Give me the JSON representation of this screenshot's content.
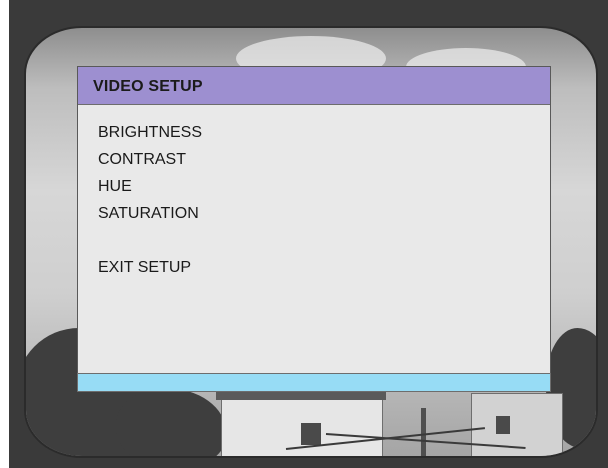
{
  "menu": {
    "title": "VIDEO SETUP",
    "items": [
      {
        "label": "BRIGHTNESS"
      },
      {
        "label": "CONTRAST"
      },
      {
        "label": "HUE"
      },
      {
        "label": "SATURATION"
      }
    ],
    "exit_label": "EXIT SETUP",
    "colors": {
      "header": "#9d8fd0",
      "panel": "#e9e9e9",
      "status_bar": "#97dcf5"
    }
  }
}
